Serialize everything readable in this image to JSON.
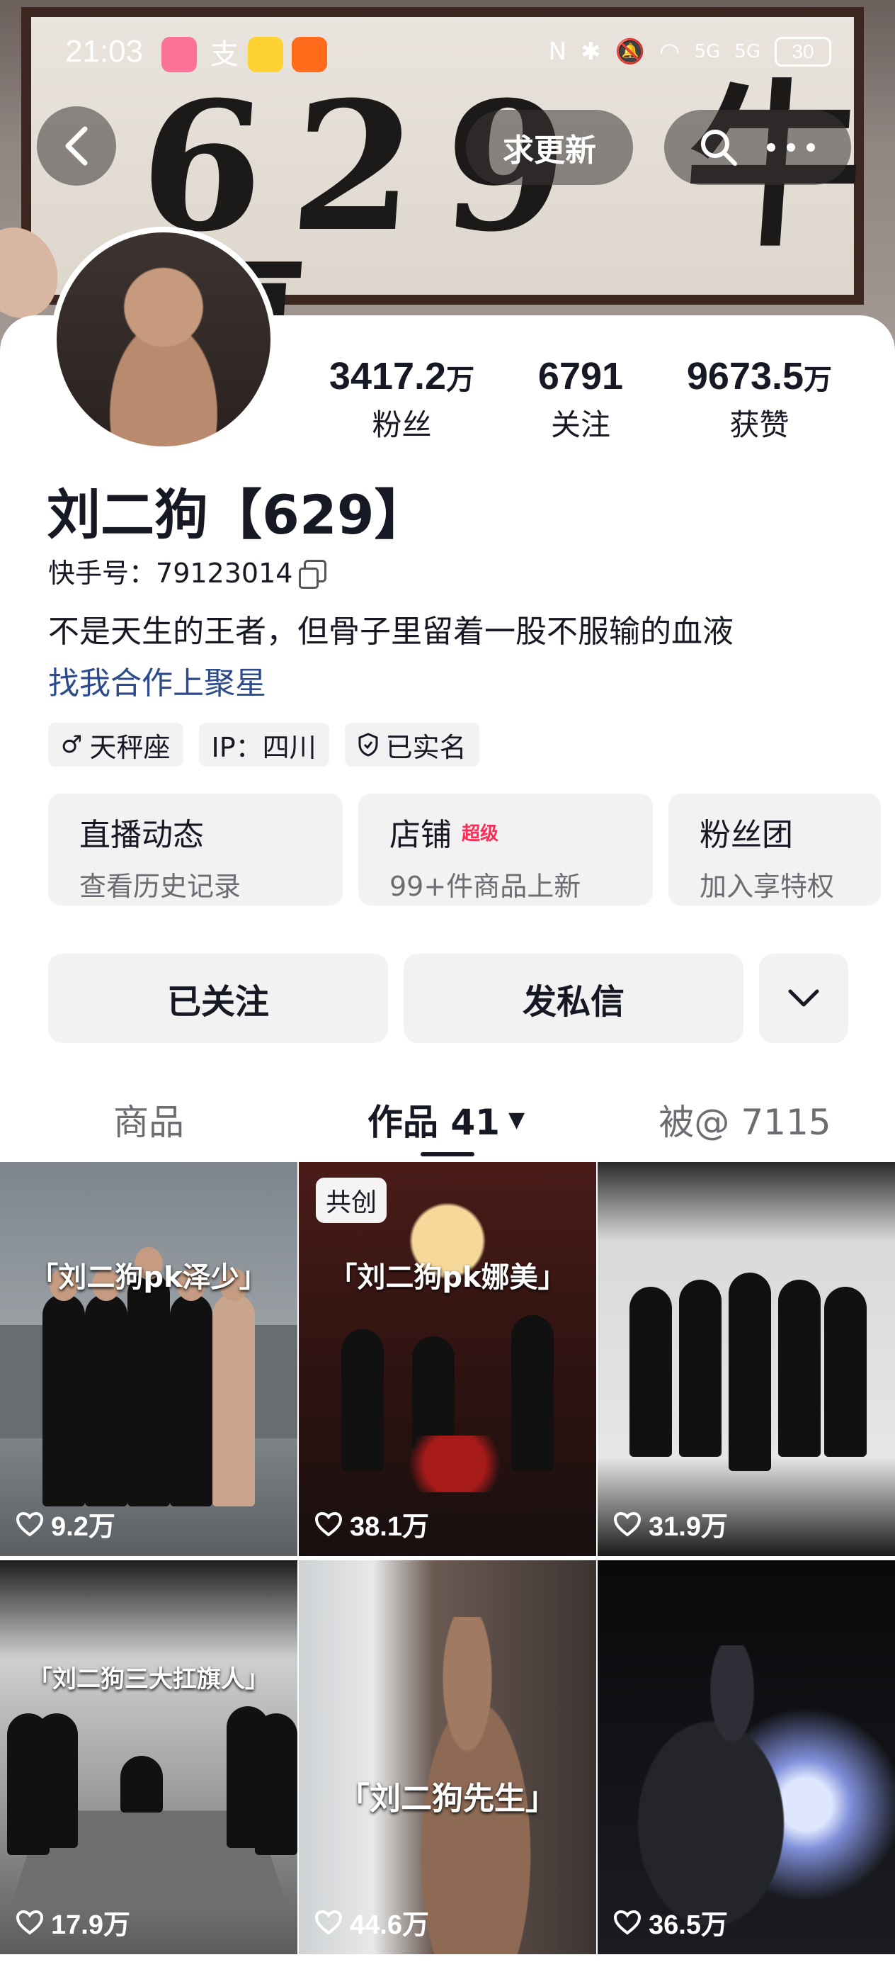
{
  "status_bar": {
    "time": "21:03",
    "battery": "30",
    "network": "5G"
  },
  "banner": {
    "calligraphy": "629 牛逼"
  },
  "header": {
    "refresh_label": "求更新"
  },
  "profile": {
    "stats": [
      {
        "value": "3417.2",
        "unit": "万",
        "label": "粉丝"
      },
      {
        "value": "6791",
        "unit": "",
        "label": "关注"
      },
      {
        "value": "9673.5",
        "unit": "万",
        "label": "获赞"
      }
    ],
    "name": "刘二狗【629】",
    "account_label": "快手号：",
    "account_id": "79123014",
    "bio": "不是天生的王者，但骨子里留着一股不服输的血液",
    "link": "找我合作上聚星",
    "tags": [
      {
        "icon": "male-icon",
        "label": "天秤座"
      },
      {
        "icon": "",
        "label": "IP：四川"
      },
      {
        "icon": "shield-icon",
        "label": "已实名"
      }
    ],
    "cards": [
      {
        "title": "直播动态",
        "badge": "",
        "subtitle": "查看历史记录"
      },
      {
        "title": "店铺",
        "badge": "超级",
        "subtitle": "99+件商品上新"
      },
      {
        "title": "粉丝团",
        "badge": "",
        "subtitle": "加入享特权"
      }
    ]
  },
  "actions": {
    "follow": "已关注",
    "message": "发私信"
  },
  "tabs": [
    {
      "label": "商品"
    },
    {
      "label": "作品 41"
    },
    {
      "label": "被@ 7115"
    }
  ],
  "videos": [
    {
      "caption": "「刘二狗pk泽少」",
      "likes": "9.2万",
      "co_label": ""
    },
    {
      "caption": "「刘二狗pk娜美」",
      "likes": "38.1万",
      "co_label": "共创"
    },
    {
      "caption": "",
      "likes": "31.9万",
      "co_label": ""
    },
    {
      "caption": "「刘二狗三大扛旗人」",
      "likes": "17.9万",
      "co_label": ""
    },
    {
      "caption": "「刘二狗先生」",
      "likes": "44.6万",
      "co_label": ""
    },
    {
      "caption": "",
      "likes": "36.5万",
      "co_label": ""
    }
  ]
}
